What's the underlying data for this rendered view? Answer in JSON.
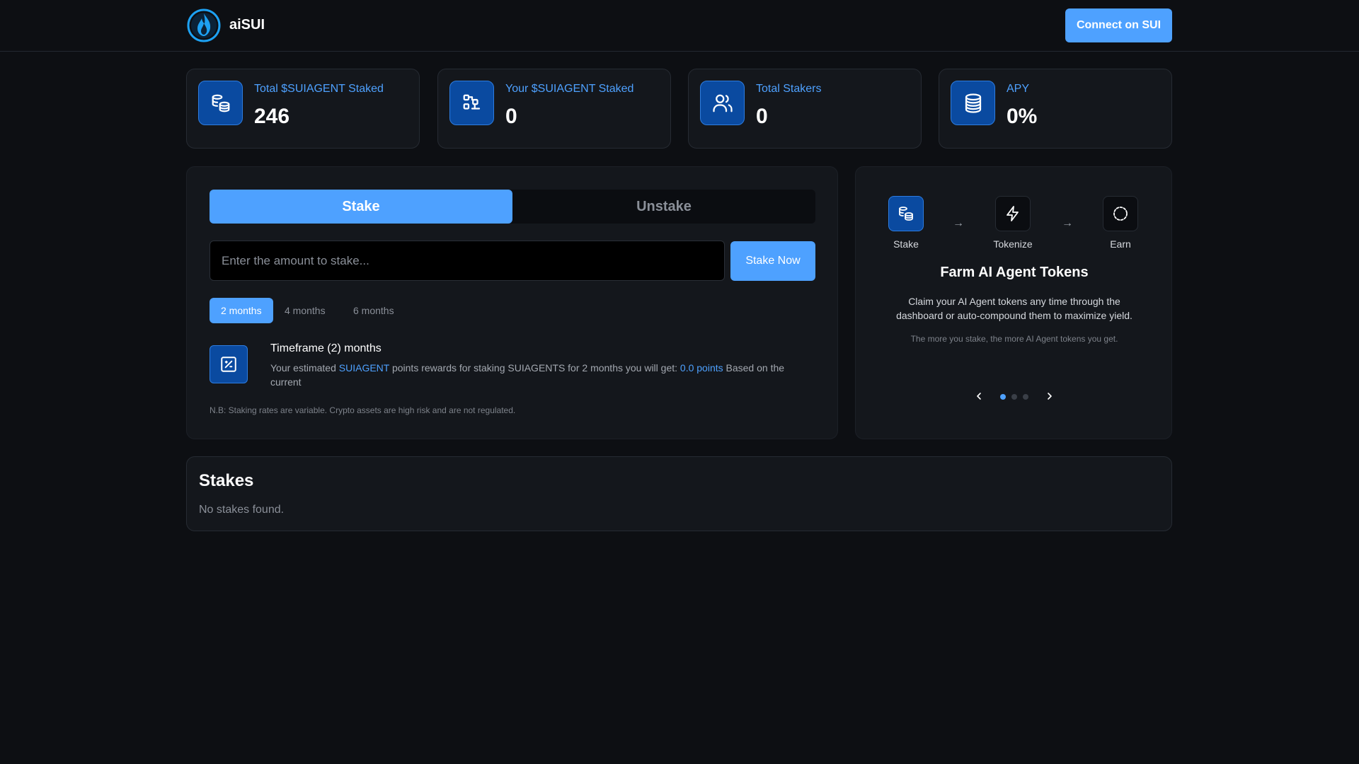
{
  "header": {
    "brand": "aiSUI",
    "logo_icon": "flame-logo-icon",
    "connect_label": "Connect on SUI"
  },
  "stats": [
    {
      "label": "Total $SUIAGENT Staked",
      "value": "246",
      "icon": "coins-stack-icon"
    },
    {
      "label": "Your $SUIAGENT Staked",
      "value": "0",
      "icon": "blocks-transfer-icon"
    },
    {
      "label": "Total Stakers",
      "value": "0",
      "icon": "users-icon"
    },
    {
      "label": "APY",
      "value": "0%",
      "icon": "database-icon"
    }
  ],
  "stake_panel": {
    "tabs": [
      {
        "label": "Stake",
        "active": true
      },
      {
        "label": "Unstake",
        "active": false
      }
    ],
    "amount_placeholder": "Enter the amount to stake...",
    "amount_value": "",
    "stake_now_label": "Stake Now",
    "durations": [
      {
        "label": "2 months",
        "active": true
      },
      {
        "label": "4 months",
        "active": false
      },
      {
        "label": "6 months",
        "active": false
      }
    ],
    "timeframe": {
      "icon": "percent-square-icon",
      "title": "Timeframe (2) months",
      "desc_prefix": "Your estimated ",
      "desc_token": "SUIAGENT",
      "desc_middle": " points rewards for staking SUIAGENTS for 2 months you will get: ",
      "desc_points": "0.0 points",
      "desc_suffix": " Based on the current"
    },
    "note": "N.B: Staking rates are variable. Crypto assets are high risk and are not regulated."
  },
  "info_panel": {
    "steps": [
      {
        "label": "Stake",
        "icon": "coins-stack-icon",
        "active": true
      },
      {
        "label": "Tokenize",
        "icon": "lightning-icon",
        "active": false
      },
      {
        "label": "Earn",
        "icon": "scan-coin-icon",
        "active": false
      }
    ],
    "title": "Farm AI Agent Tokens",
    "description": "Claim your AI Agent tokens any time through the dashboard or auto-compound them to maximize yield.",
    "note": "The more you stake, the more AI Agent tokens you get.",
    "carousel": {
      "slides": 3,
      "current": 1
    }
  },
  "stakes": {
    "title": "Stakes",
    "empty": "No stakes found."
  },
  "colors": {
    "background": "#0d0f13",
    "panel": "#14171c",
    "accent": "#4ea1ff",
    "icon_bg": "#0a4aa0"
  }
}
